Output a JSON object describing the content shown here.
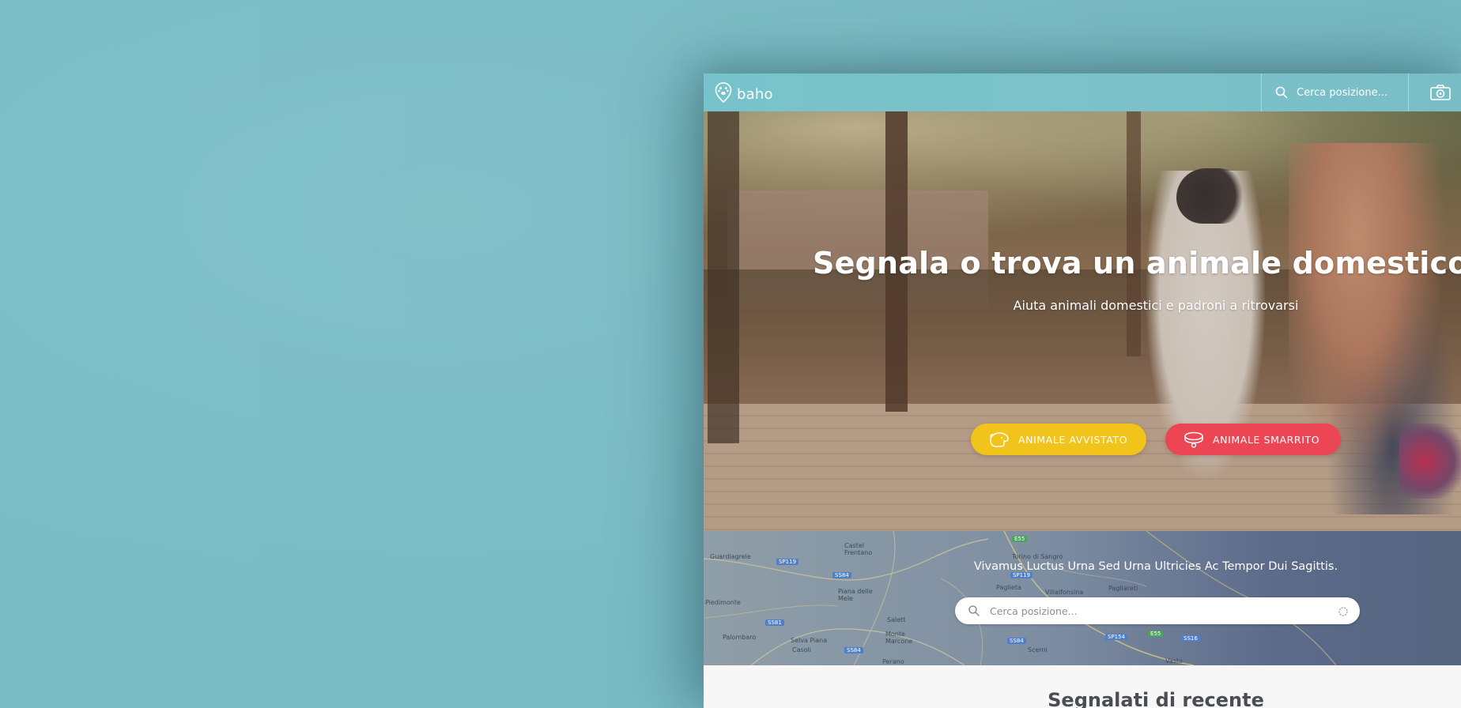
{
  "colors": {
    "background": "#7bbcc4",
    "header": "#7cc1c9",
    "cta_seen": "#f2c31a",
    "cta_lost": "#ec4553",
    "band": "#5c6b8a"
  },
  "header": {
    "brand": "baho",
    "logo_icon": "paw-pin-icon",
    "search_placeholder": "Cerca posizione...",
    "search_icon": "search-icon",
    "camera_icon": "camera-icon"
  },
  "hero": {
    "title": "Segnala o trova un animale domestico smarrito",
    "subtitle": "Aiuta animali domestici e padroni a ritrovarsi",
    "buttons": [
      {
        "label": "ANIMALE AVVISTATO",
        "icon": "dog-head-icon"
      },
      {
        "label": "ANIMALE SMARRITO",
        "icon": "pet-collar-icon"
      }
    ]
  },
  "map_band": {
    "heading": "Vivamus Luctus Urna Sed Urna Ultricies Ac Tempor Dui Sagittis.",
    "search_placeholder": "Cerca posizione...",
    "search_icon": "search-icon",
    "locate_icon": "locate-icon",
    "map_labels": [
      "Guardiagrele",
      "Castel Frentano",
      "Torino di Sangro",
      "Paglieta",
      "Villalfonsina",
      "Pagliareti",
      "Piana delle Mele",
      "Piedimonte",
      "Palombaro",
      "Selva Piana",
      "Casoli",
      "Monte Marcone",
      "Scerni",
      "Vasto",
      "Salett",
      "Perano"
    ],
    "road_shields": [
      "SP119",
      "SP119",
      "SS84",
      "SS81",
      "SS84",
      "SS84",
      "SP154",
      "SS16",
      "E55",
      "E55"
    ]
  },
  "recent": {
    "title": "Segnalati di recente"
  }
}
